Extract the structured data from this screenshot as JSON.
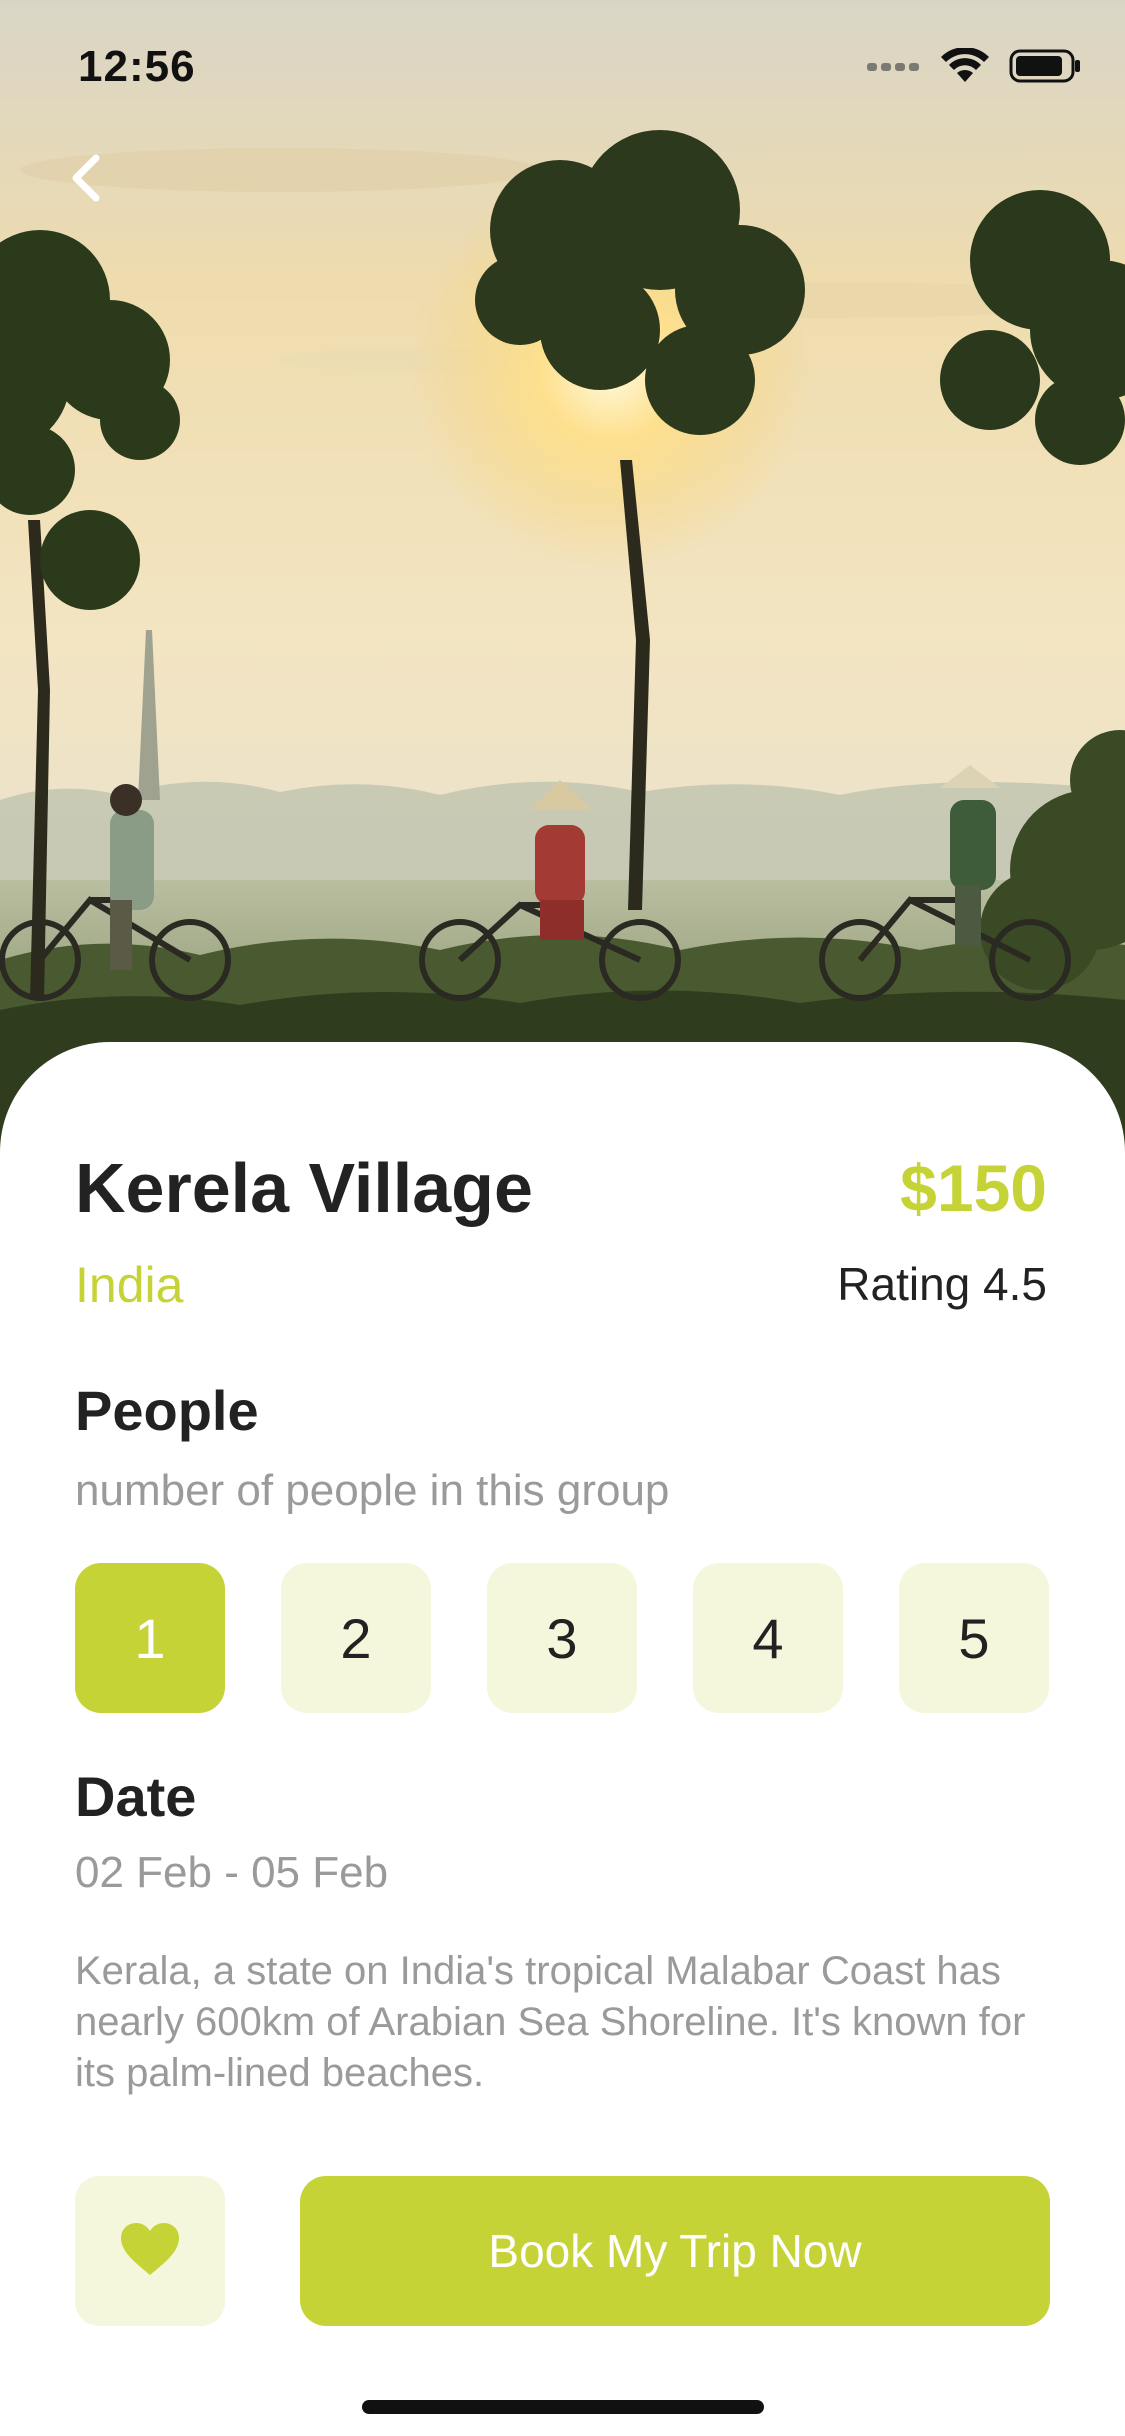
{
  "status_bar": {
    "time": "12:56"
  },
  "destination": {
    "title": "Kerela Village",
    "country": "India",
    "price": "$150",
    "rating": "Rating 4.5"
  },
  "people": {
    "title": "People",
    "subtitle": "number of people in this group",
    "options": [
      "1",
      "2",
      "3",
      "4",
      "5"
    ],
    "selected": "1"
  },
  "date": {
    "title": "Date",
    "range": "02 Feb - 05 Feb"
  },
  "description": "Kerala, a state on India's tropical Malabar Coast has nearly 600km of Arabian Sea Shoreline. It's known for its palm-lined beaches.",
  "actions": {
    "book_label": "Book My Trip Now"
  },
  "icons": {
    "back": "chevron-left-icon",
    "favorite": "heart-icon",
    "signal": "signal-icon",
    "wifi": "wifi-icon",
    "battery": "battery-icon"
  },
  "colors": {
    "accent": "#c6d336",
    "accent_light": "#f4f7dc",
    "text_dark": "#222222",
    "text_muted": "#9a9a9a"
  }
}
